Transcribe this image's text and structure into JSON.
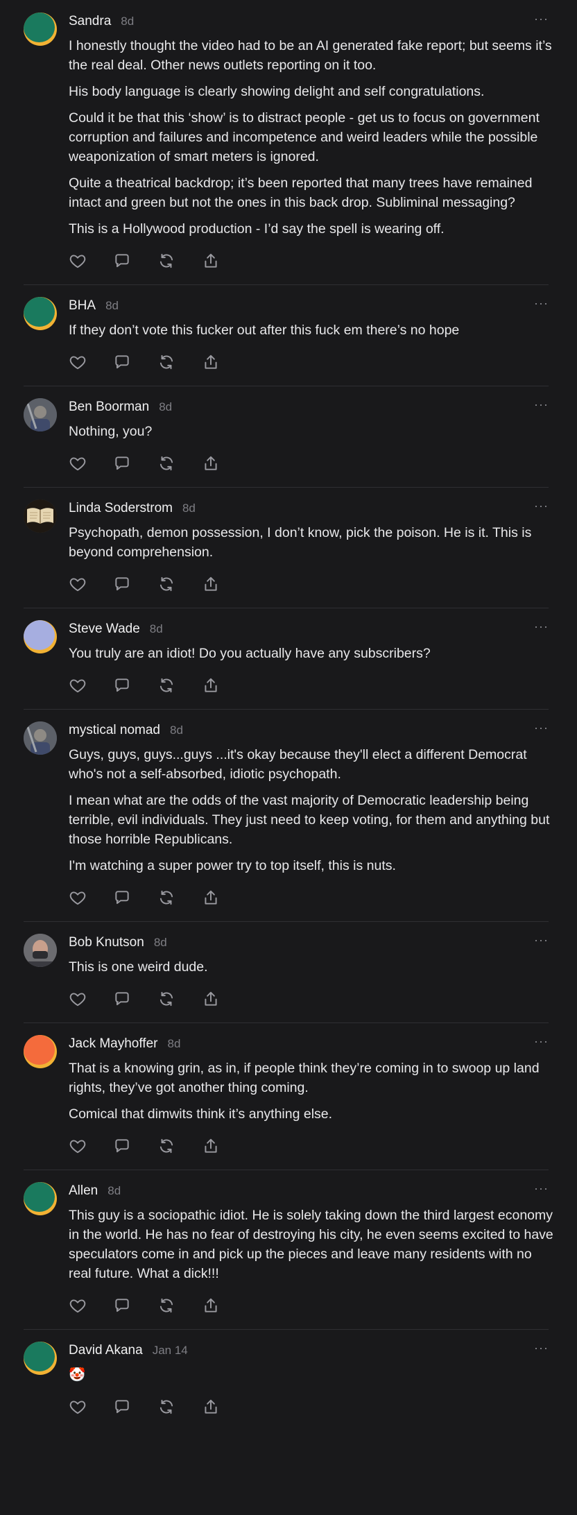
{
  "comments": [
    {
      "name": "Sandra",
      "time": "8d",
      "avatar": "generic-teal",
      "paragraphs": [
        "I honestly thought the video had to be an AI generated fake report; but seems it’s the real deal. Other news outlets reporting on it too.",
        "His body language is clearly showing delight and self congratulations.",
        "Could it be that this ‘show’ is to distract people - get us to focus on government corruption and failures and incompetence and weird leaders while the possible weaponization of smart meters is ignored.",
        "Quite a theatrical backdrop; it’s been reported that many trees have remained intact and green but not the ones in this back drop. Subliminal messaging?",
        "This is a Hollywood production - I’d say the spell is wearing off."
      ]
    },
    {
      "name": "BHA",
      "time": "8d",
      "avatar": "generic-teal",
      "paragraphs": [
        "If they don’t vote this fucker out after this fuck em there’s no hope"
      ]
    },
    {
      "name": "Ben Boorman",
      "time": "8d",
      "avatar": "photo",
      "paragraphs": [
        "Nothing, you?"
      ]
    },
    {
      "name": "Linda Soderstrom",
      "time": "8d",
      "avatar": "book",
      "paragraphs": [
        "Psychopath, demon possession, I don’t know, pick the poison. He is it. This is beyond comprehension."
      ]
    },
    {
      "name": "Steve Wade",
      "time": "8d",
      "avatar": "generic-lavender",
      "paragraphs": [
        "You truly are an idiot! Do you actually have any subscribers?"
      ]
    },
    {
      "name": "mystical nomad",
      "time": "8d",
      "avatar": "photo",
      "paragraphs": [
        "Guys, guys, guys...guys ...it's okay because they'll elect a different Democrat who's not a self-absorbed, idiotic psychopath.",
        "I mean what are the odds of the vast majority of Democratic leadership being terrible, evil individuals. They just need to keep voting, for them and anything but those horrible Republicans.",
        "I'm watching a super power try to top itself, this is nuts."
      ]
    },
    {
      "name": "Bob Knutson",
      "time": "8d",
      "avatar": "face",
      "paragraphs": [
        "This is one weird dude."
      ]
    },
    {
      "name": "Jack Mayhoffer",
      "time": "8d",
      "avatar": "generic-orange",
      "paragraphs": [
        "That is a knowing grin, as in, if people think they’re coming in to swoop up land rights, they’ve got another thing coming.",
        "Comical that dimwits think it’s anything else."
      ]
    },
    {
      "name": "Allen",
      "time": "8d",
      "avatar": "generic-teal",
      "paragraphs": [
        "This guy is a sociopathic idiot. He is solely taking down the third largest economy in the world. He has no fear of destroying his city, he even seems excited to have speculators come in and pick up the pieces and leave many residents with no real future. What a dick!!!"
      ]
    },
    {
      "name": "David Akana",
      "time": "Jan 14",
      "avatar": "generic-teal",
      "paragraphs": [
        "🤡"
      ]
    }
  ],
  "more_label": "···",
  "actions": [
    "like",
    "reply",
    "restack",
    "share"
  ],
  "icons": {
    "like": "heart-icon",
    "reply": "comment-icon",
    "restack": "restack-icon",
    "share": "share-icon",
    "more": "more-icon"
  },
  "colors": {
    "background": "#19191b",
    "text": "#ececed",
    "muted": "#7e7e84",
    "avatar_teal": "#1a7a5e",
    "avatar_ring": "#f2b234",
    "avatar_lavender": "#a6aee0",
    "avatar_orange": "#f46b3c"
  }
}
